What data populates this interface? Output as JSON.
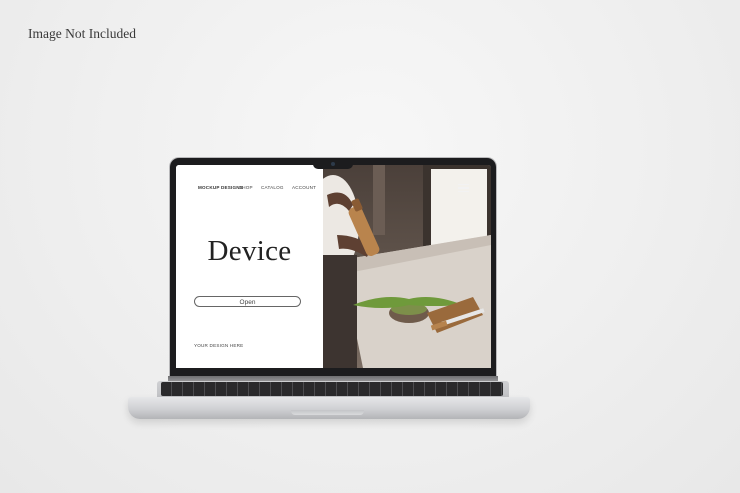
{
  "caption": "Image Not Included",
  "website": {
    "nav": {
      "brand": "MOCKUP DESIGNS",
      "shop": "SHOP",
      "catalog": "CATALOG",
      "account": "ACCOUNT"
    },
    "hero_title": "Device",
    "open_button": "Open",
    "footer_text": "YOUR DESIGN HERE",
    "menu_icon": "hamburger-menu-icon"
  },
  "colors": {
    "background": "#efefef",
    "laptop_bezel": "#1c1c1e",
    "laptop_body": "#cfd0d3",
    "photo_tone": "#5c5048"
  }
}
